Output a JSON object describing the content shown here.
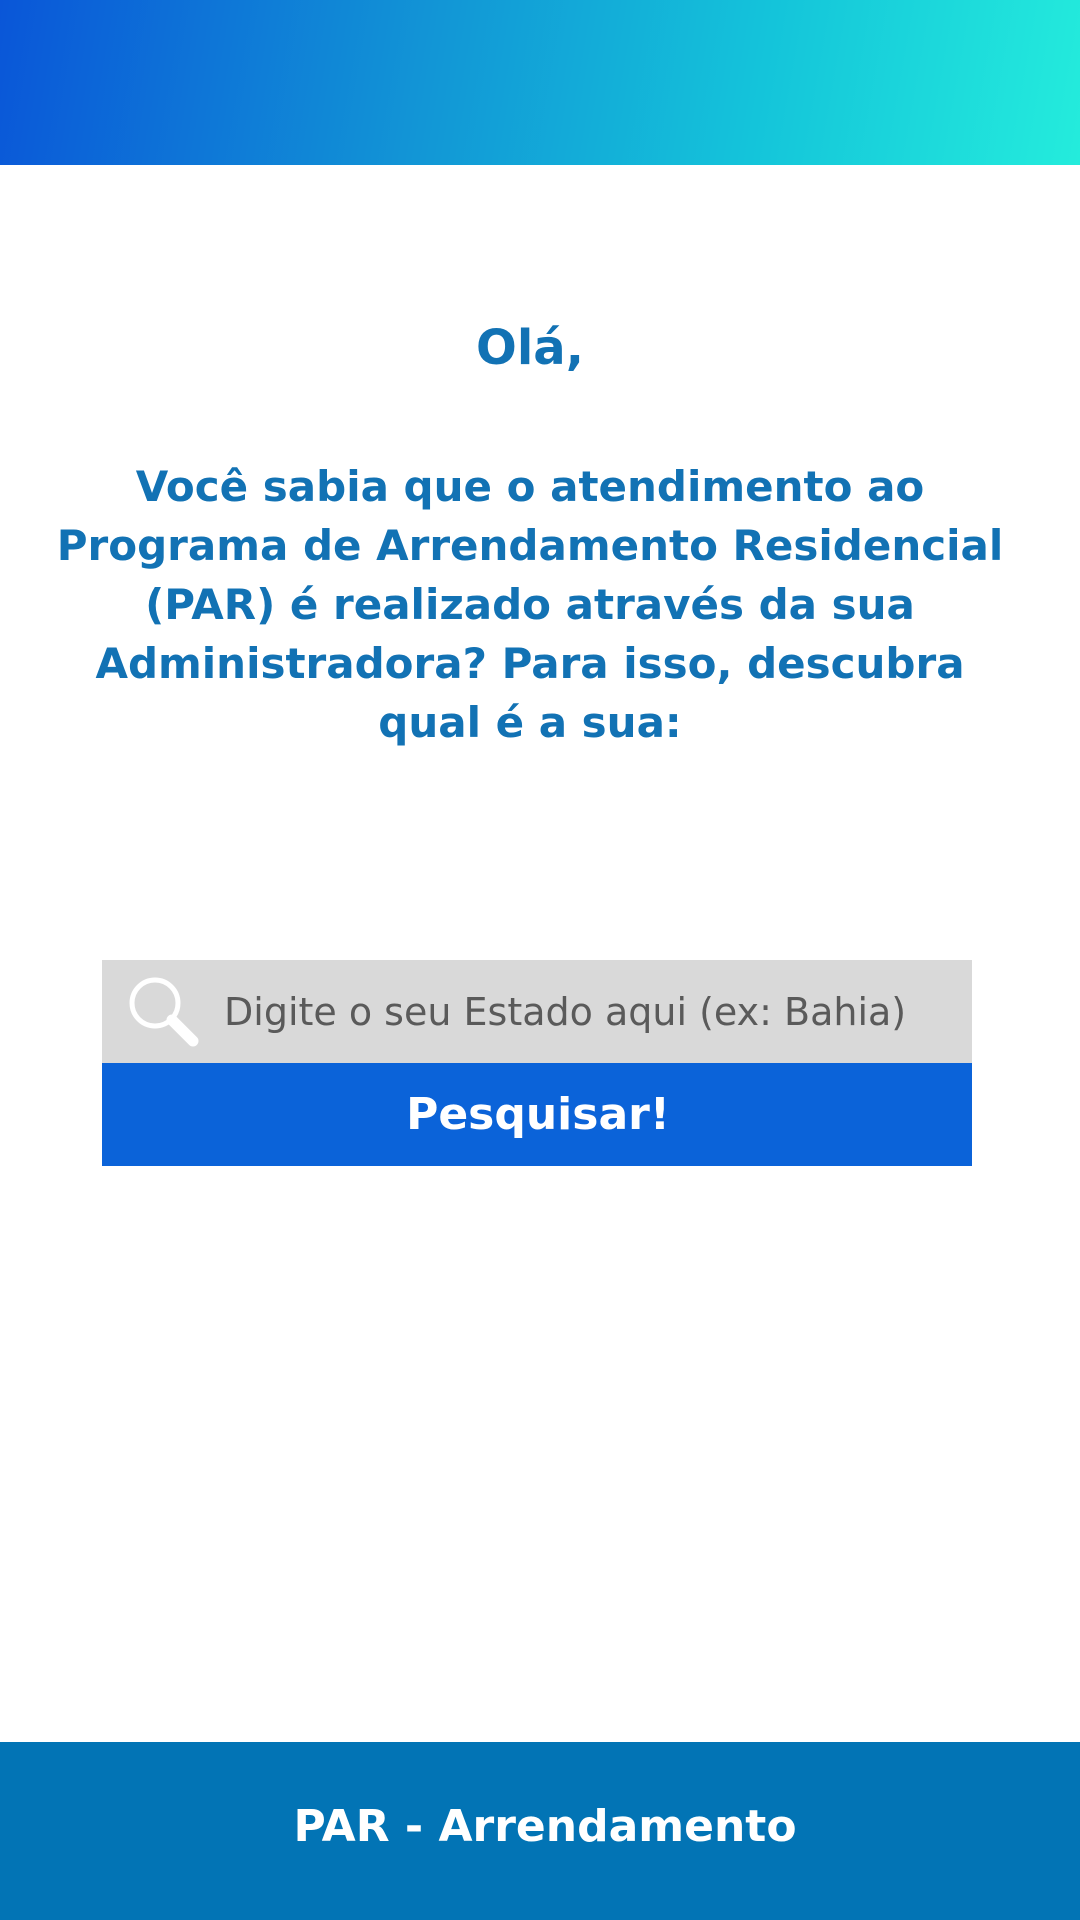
{
  "header": {
    "gradient_start": "#0a56d8",
    "gradient_end": "#24ecdc"
  },
  "main": {
    "greeting": "Olá,",
    "intro": "Você sabia que o atendimento ao Programa de Arrendamento Residencial (PAR) é realizado através da sua Administradora? Para isso, descubra qual é a sua:",
    "text_color": "#1272b4"
  },
  "search": {
    "icon": "search-icon",
    "placeholder": "Digite o seu Estado aqui (ex: Bahia)",
    "value": "",
    "button_label": "Pesquisar!",
    "button_color": "#0b63d9"
  },
  "footer": {
    "title": "PAR - Arrendamento",
    "background": "#0274b5"
  }
}
